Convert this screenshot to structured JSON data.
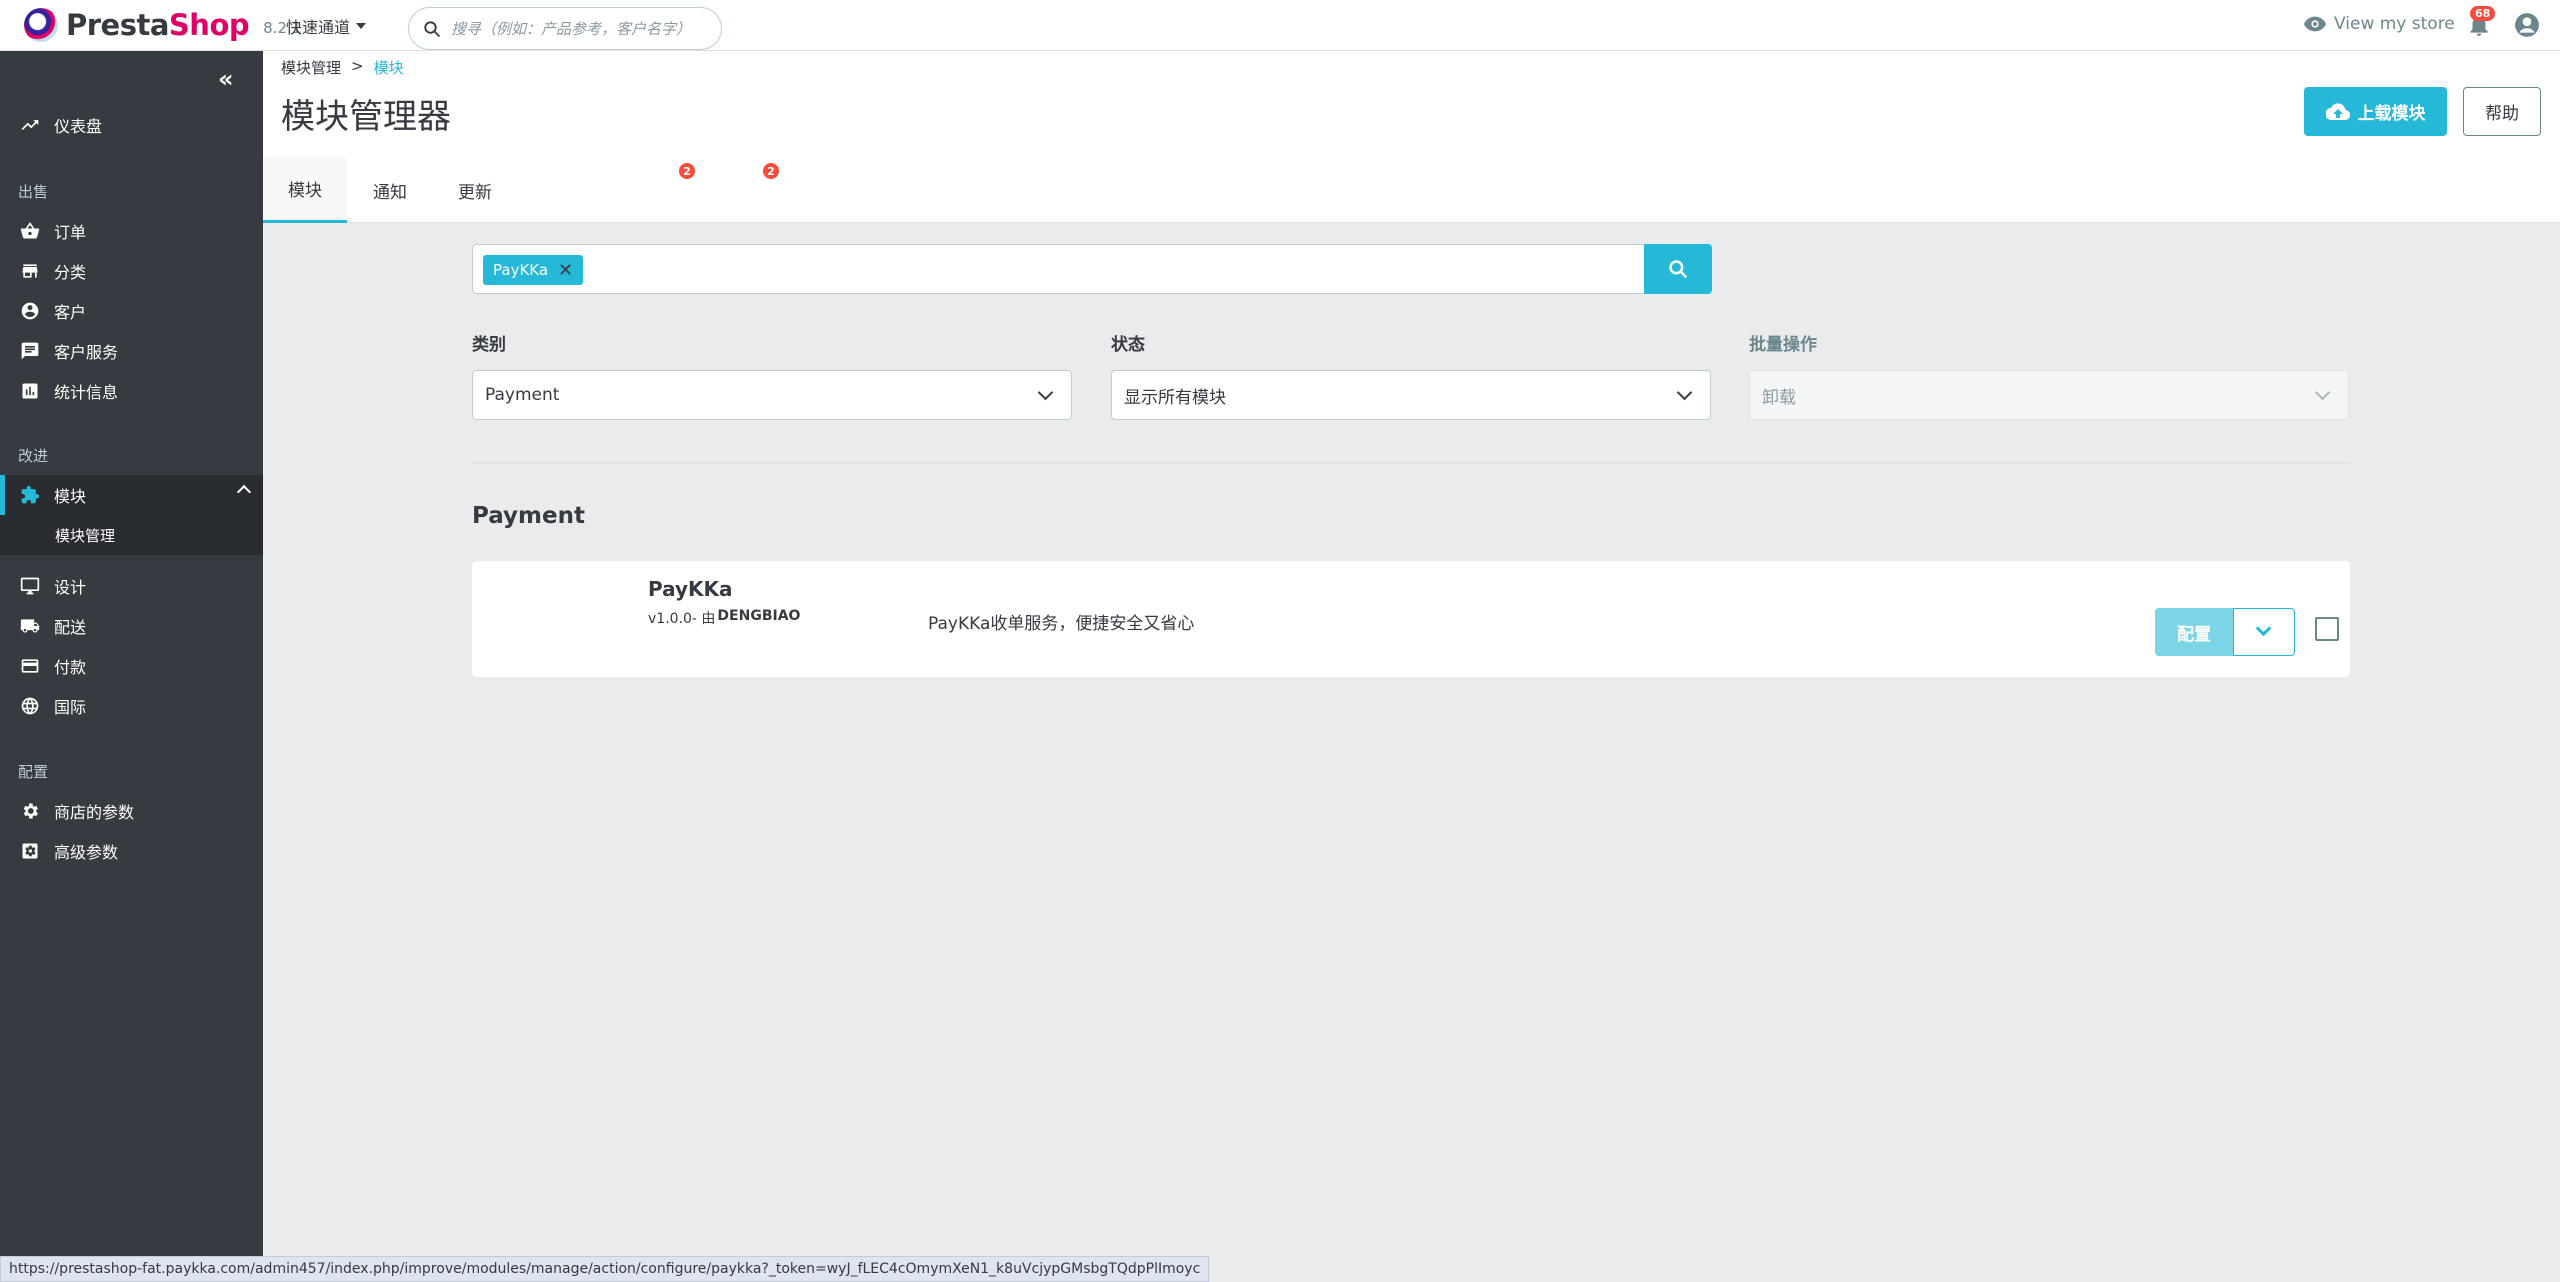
{
  "header": {
    "logo_text_a": "Presta",
    "logo_text_b": "Shop",
    "version": "8.2.1",
    "quick_access": "快速通道",
    "search_placeholder": "搜寻（例如：产品参考，客户名字）",
    "view_store": "View my store",
    "notification_count": "68"
  },
  "sidebar": {
    "dashboard": "仪表盘",
    "sections": {
      "sell": "出售",
      "improve": "改进",
      "configure": "配置"
    },
    "sell_items": [
      "订单",
      "分类",
      "客户",
      "客户服务",
      "统计信息"
    ],
    "improve_items": {
      "modules": "模块",
      "module_manager": "模块管理",
      "design": "设计",
      "shipping": "配送",
      "payment": "付款",
      "international": "国际"
    },
    "configure_items": [
      "商店的参数",
      "高级参数"
    ]
  },
  "page": {
    "breadcrumb": [
      "模块管理",
      ">",
      "模块"
    ],
    "title": "模块管理器",
    "upload_button": "上载模块",
    "help_button": "帮助"
  },
  "tabs": [
    {
      "label": "模块",
      "badge": ""
    },
    {
      "label": "通知",
      "badge": "2"
    },
    {
      "label": "更新",
      "badge": "2"
    }
  ],
  "filters": {
    "tag": "PayKKa",
    "category_label": "类别",
    "category_value": "Payment",
    "status_label": "状态",
    "status_value": "显示所有模块",
    "bulk_label": "批量操作",
    "bulk_value": "卸载"
  },
  "section": {
    "title": "Payment",
    "module": {
      "name": "PayKKa",
      "version": "v1.0.0- 由",
      "author": "DENGBIAO",
      "description": "PayKKa收单服务，便捷安全又省心",
      "config_button": "配置"
    }
  },
  "status_bar": "https://prestashop-fat.paykka.com/admin457/index.php/improve/modules/manage/action/configure/paykka?_token=wyJ_fLEC4cOmymXeN1_k8uVcjypGMsbgTQdpPlImoyc",
  "colors": {
    "accent": "#25b9d7",
    "sidebar_bg": "#363a41",
    "badge": "#f54c3e"
  }
}
